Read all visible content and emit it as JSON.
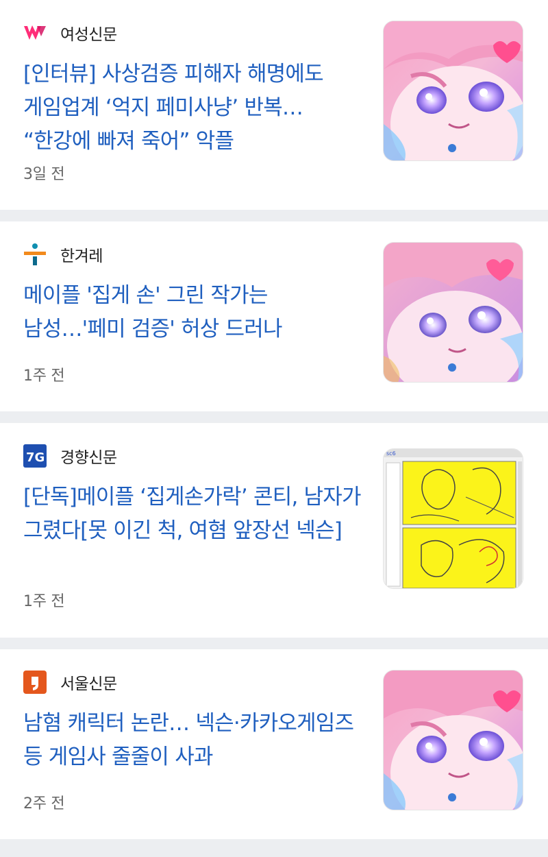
{
  "articles": [
    {
      "source": "여성신문",
      "logo": "womennews-logo-icon",
      "headline": "[인터뷰] 사상검증 피해자 해명에도 게임업계 ‘억지 페미사냥’ 반복… “한강에 빠져 죽어” 악플",
      "time": "3일 전",
      "thumbnail": "anime-girl-thumbnail"
    },
    {
      "source": "한겨레",
      "logo": "hani-logo-icon",
      "headline": "메이플 '집게 손' 그린 작가는 남성…'페미 검증' 허상 드러나",
      "time": "1주 전",
      "thumbnail": "anime-girl-thumbnail"
    },
    {
      "source": "경향신문",
      "logo": "khan-logo-icon",
      "headline": "[단독]메이플 ‘집게손가락’ 콘티, 남자가 그렸다[못 이긴 척, 여혐 앞장선 넥슨]",
      "time": "1주 전",
      "thumbnail": "storyboard-sketch-thumbnail"
    },
    {
      "source": "서울신문",
      "logo": "seoul-logo-icon",
      "headline": "남혐 캐릭터 논란… 넥슨·카카오게임즈 등 게임사 줄줄이 사과",
      "time": "2주 전",
      "thumbnail": "anime-girl-thumbnail"
    }
  ],
  "colors": {
    "headline": "#1f5fbf",
    "source": "#222222",
    "time": "#666666",
    "card_background": "#ffffff",
    "feed_background": "#eceef1"
  }
}
